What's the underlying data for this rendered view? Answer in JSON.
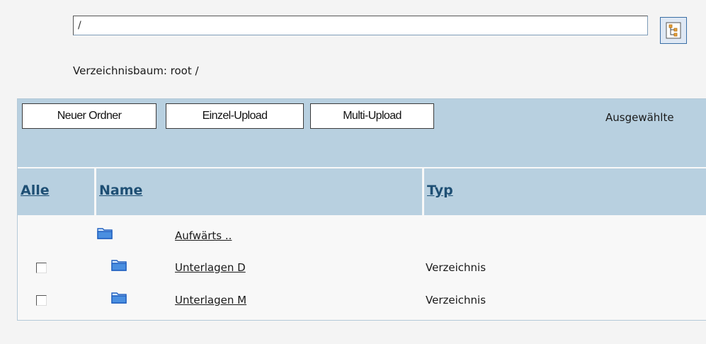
{
  "path": {
    "value": "/"
  },
  "tree_caption": "Verzeichnisbaum: root /",
  "toolbar": {
    "new_folder": "Neuer Ordner",
    "single_upload": "Einzel-Upload",
    "multi_upload": "Multi-Upload",
    "selected_label": "Ausgewählte"
  },
  "columns": {
    "all": "Alle",
    "name": "Name",
    "type": "Typ"
  },
  "rows": [
    {
      "name": "Aufwärts ..",
      "type": ""
    },
    {
      "name": "Unterlagen D",
      "type": "Verzeichnis"
    },
    {
      "name": "Unterlagen M",
      "type": "Verzeichnis"
    }
  ],
  "icons": {
    "tree": "tree-view-icon",
    "folder": "folder-icon"
  },
  "colors": {
    "header_bg": "#b8d0e0",
    "link": "#1e4f74",
    "folder": "#3a7fd8"
  }
}
